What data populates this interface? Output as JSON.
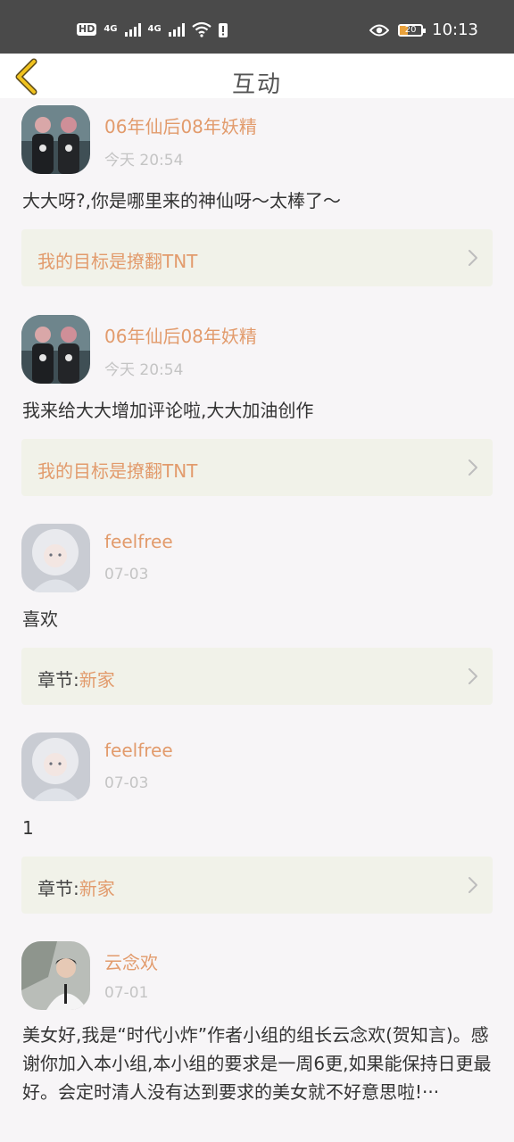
{
  "status_bar": {
    "hd": "HD",
    "net1": "4G",
    "net2": "4G",
    "battery": "20",
    "time": "10:13"
  },
  "nav": {
    "title": "互动"
  },
  "posts": [
    {
      "username": "06年仙后08年妖精",
      "time": "今天 20:54",
      "content": "大大呀?,你是哪里来的神仙呀～太棒了～",
      "target_prefix": "",
      "target": "我的目标是撩翻TNT"
    },
    {
      "username": "06年仙后08年妖精",
      "time": "今天 20:54",
      "content": "我来给大大增加评论啦,大大加油创作",
      "target_prefix": "",
      "target": "我的目标是撩翻TNT"
    },
    {
      "username": "feelfree",
      "time": "07-03",
      "content": "喜欢",
      "target_prefix": "章节:",
      "target": "新家"
    },
    {
      "username": "feelfree",
      "time": "07-03",
      "content": "1",
      "target_prefix": "章节:",
      "target": "新家"
    },
    {
      "username": "云念欢",
      "time": "07-01",
      "content": "美女好,我是“时代小炸”作者小组的组长云念欢(贺知言)。感谢你加入本小组,本小组的要求是一周6更,如果能保持日更最好。会定时清人没有达到要求的美女就不好意思啦!···"
    }
  ],
  "colors": {
    "accent": "#e29b6c",
    "card_bg": "#f1f2e9",
    "page_bg": "#f7f5f7",
    "back_icon": "#f0c21e"
  },
  "icons": {
    "back": "chevron-left-icon",
    "card": "chevron-right-icon"
  }
}
